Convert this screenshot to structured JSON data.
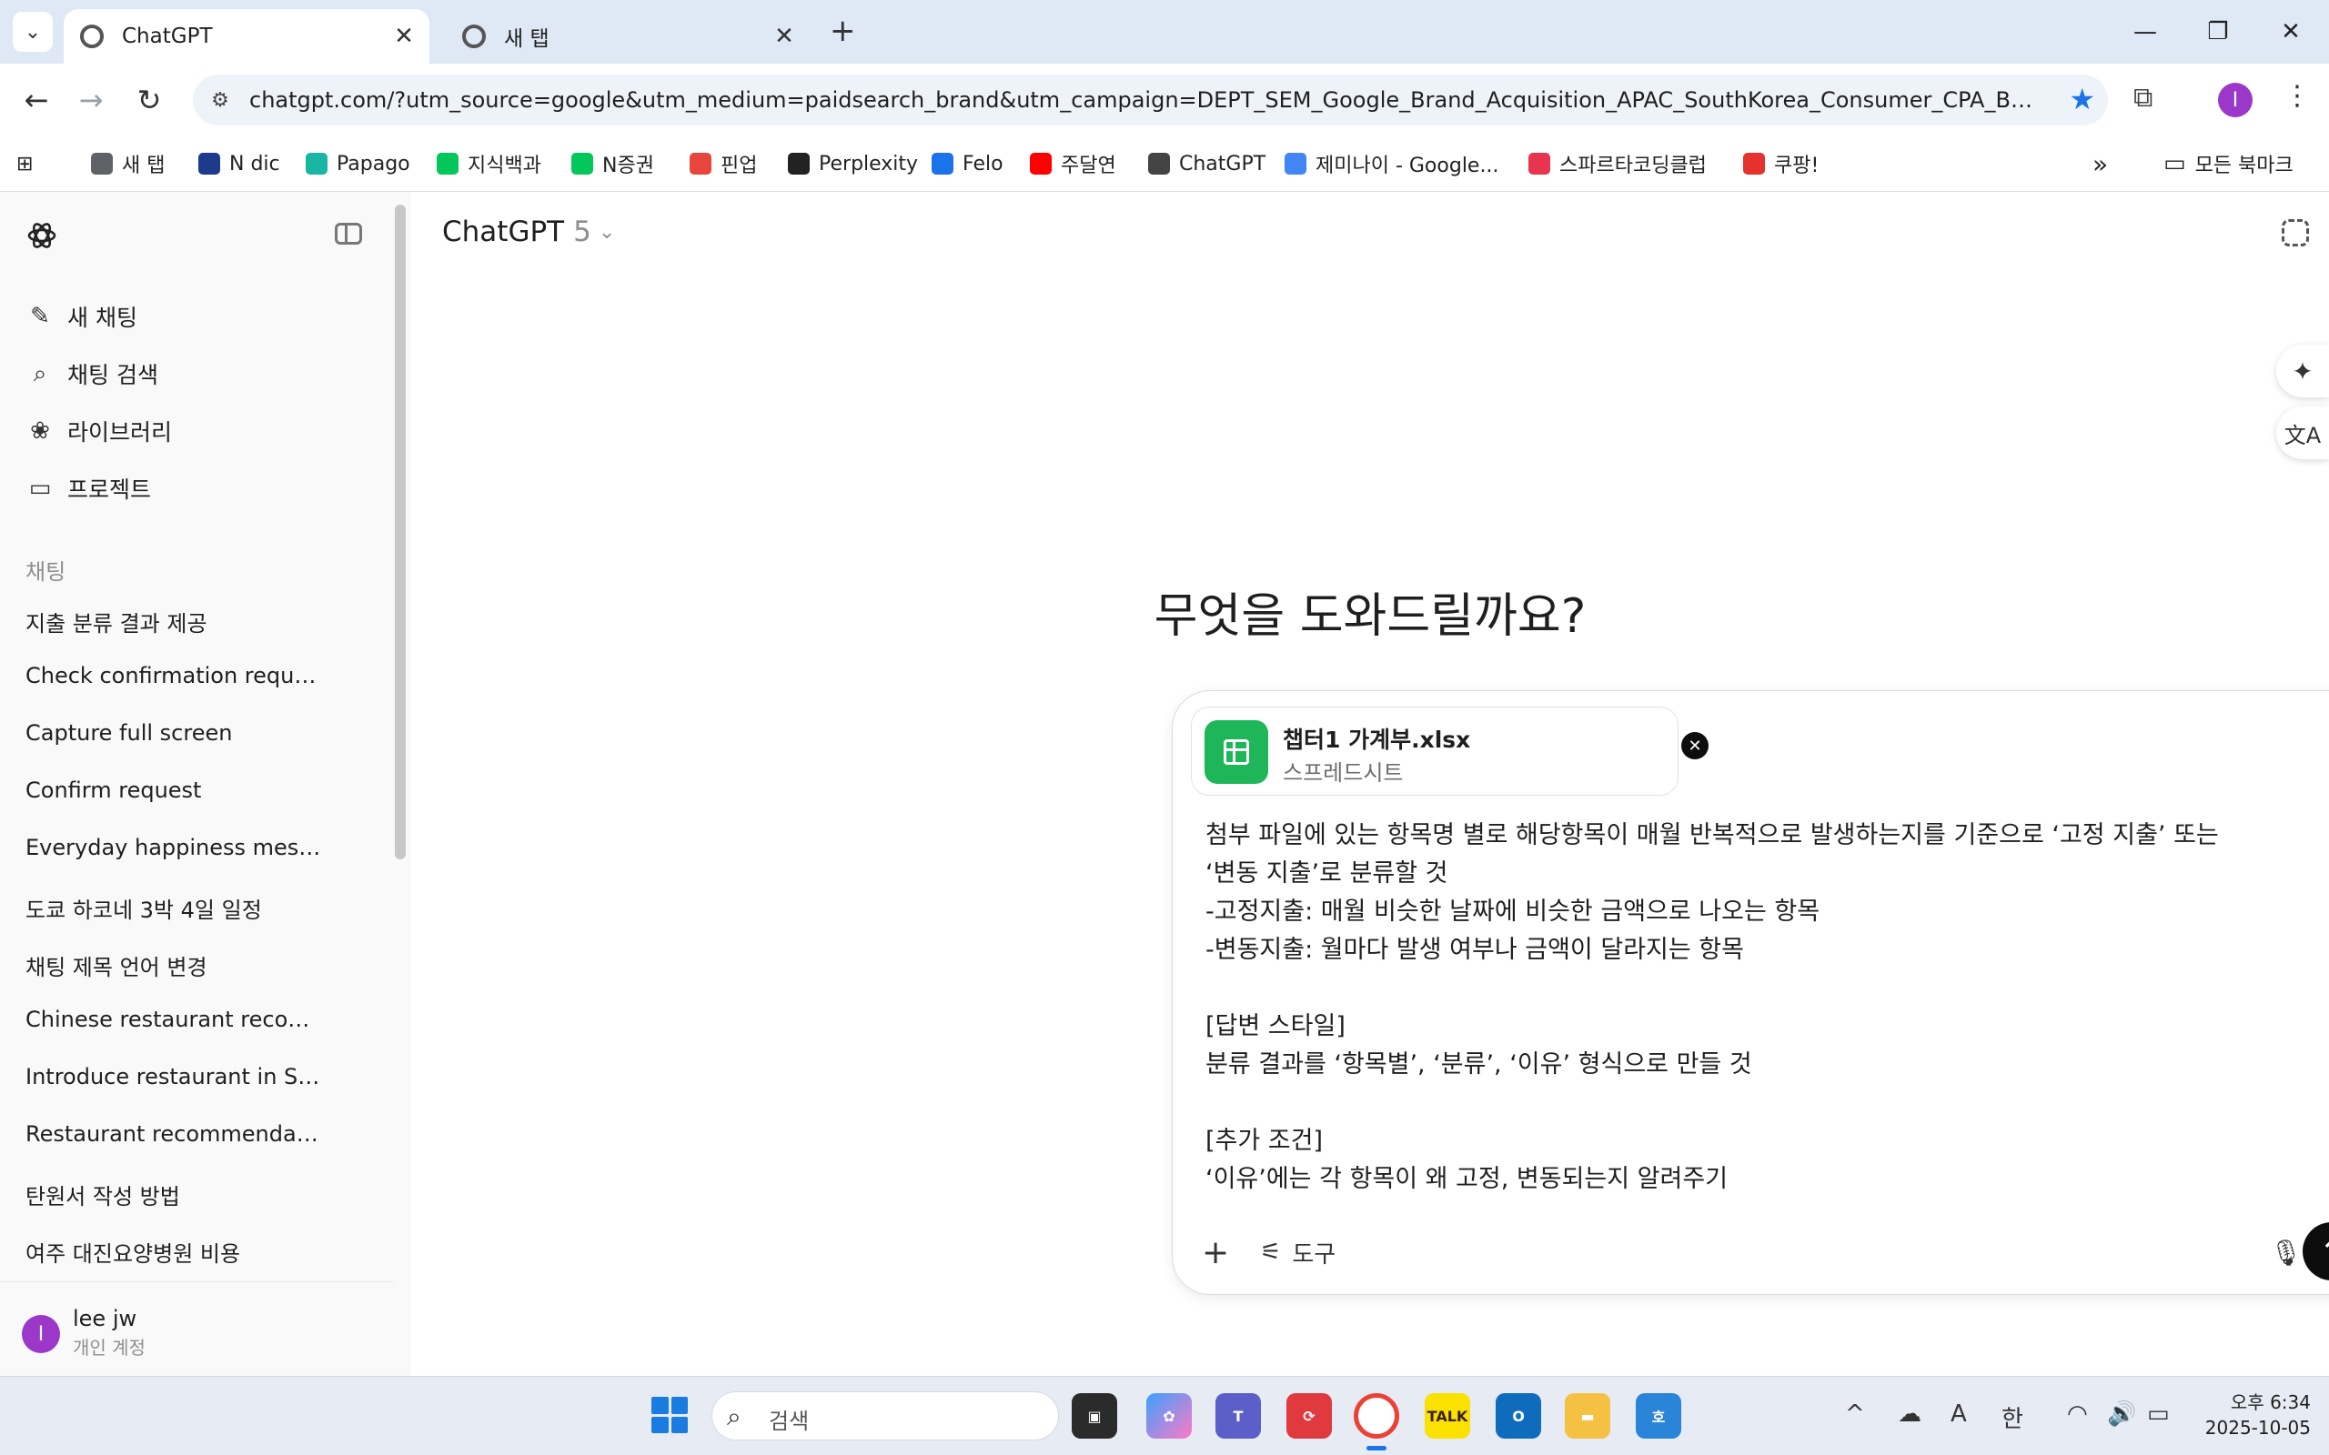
{
  "browser": {
    "tabs": [
      {
        "title": "ChatGPT",
        "active": true
      },
      {
        "title": "새 탭",
        "active": false
      }
    ],
    "new_tab_symbol": "+",
    "window_controls": {
      "minimize": "—",
      "restore": "❐",
      "close": "✕"
    },
    "url": "chatgpt.com/?utm_source=google&utm_medium=paidsearch_brand&utm_campaign=DEPT_SEM_Google_Brand_Acquisition_APAC_SouthKorea_Consumer_CPA_BAU_Mix_Korea...",
    "profile_initial": "I",
    "bookmarks": [
      {
        "label": "새 탭",
        "icon": "globe-icon",
        "color": "#5f6368"
      },
      {
        "label": "N dic",
        "icon": "naver-dic-icon",
        "color": "#1e3a8a"
      },
      {
        "label": "Papago",
        "icon": "papago-icon",
        "color": "#19b6a3"
      },
      {
        "label": "지식백과",
        "icon": "encyclopedia-icon",
        "color": "#03c75a"
      },
      {
        "label": "N증권",
        "icon": "npay-icon",
        "color": "#03c75a"
      },
      {
        "label": "핀업",
        "icon": "chart-icon",
        "color": "#e8453c"
      },
      {
        "label": "Perplexity",
        "icon": "perplexity-icon",
        "color": "#222222"
      },
      {
        "label": "Felo",
        "icon": "felo-icon",
        "color": "#1a73e8"
      },
      {
        "label": "주달연",
        "icon": "youtube-icon",
        "color": "#ff0000"
      },
      {
        "label": "ChatGPT",
        "icon": "openai-icon",
        "color": "#444444"
      },
      {
        "label": "제미나이 - Google...",
        "icon": "google-icon",
        "color": "#4285f4"
      },
      {
        "label": "스파르타코딩클럽",
        "icon": "sparta-icon",
        "color": "#e8344e"
      },
      {
        "label": "쿠팡!",
        "icon": "coupang-icon",
        "color": "#e5322d"
      }
    ],
    "bookmarks_overflow": "»",
    "all_bookmarks": "모든 북마크"
  },
  "sidebar": {
    "actions": [
      {
        "label": "새 채팅",
        "icon": "pencil-square-icon",
        "glyph": "✎"
      },
      {
        "label": "채팅 검색",
        "icon": "search-icon",
        "glyph": "⌕"
      },
      {
        "label": "라이브러리",
        "icon": "library-icon",
        "glyph": "❀"
      },
      {
        "label": "프로젝트",
        "icon": "folder-icon",
        "glyph": "▭"
      }
    ],
    "section_title": "채팅",
    "chats": [
      "지출 분류 결과 제공",
      "Check confirmation request",
      "Capture full screen",
      "Confirm request",
      "Everyday happiness message",
      "도쿄 하코네 3박 4일 일정",
      "채팅 제목 언어 변경",
      "Chinese restaurant recomm...",
      "Introduce restaurant in Seo...",
      "Restaurant recommendatio...",
      "탄원서 작성 방법",
      "여주 대진요양병원 비용"
    ],
    "user": {
      "initial": "I",
      "name": "lee jw",
      "plan": "개인 계정"
    }
  },
  "main": {
    "model_name": "ChatGPT",
    "model_version": "5",
    "hero": "무엇을 도와드릴까요?",
    "attachment": {
      "name": "챕터1 가계부.xlsx",
      "type": "스프레드시트"
    },
    "prompt_lines": [
      "첨부 파일에 있는 항목명 별로 해당항목이 매월 반복적으로 발생하는지를 기준으로 ‘고정 지출’ 또는",
      "‘변동 지출’로 분류할 것",
      "-고정지출: 매월 비슷한 날짜에 비슷한 금액으로 나오는 항목",
      "-변동지출: 월마다 발생 여부나 금액이 달라지는 항목",
      "",
      "[답변 스타일]",
      "분류 결과를 ‘항목별’, ‘분류’, ‘이유’ 형식으로 만들 것",
      "",
      "[추가 조건]",
      "‘이유’에는 각 항목이 왜 고정, 변동되는지 알려주기"
    ],
    "add_symbol": "+",
    "tools_label": "도구",
    "send_symbol": "↑"
  },
  "taskbar": {
    "search_placeholder": "검색",
    "tray_caret": "^",
    "ime_a": "A",
    "ime_lang": "한",
    "time": "오후 6:34",
    "date": "2025-10-05"
  },
  "colors": {
    "accent": "#1a73e8",
    "profile": "#9b38c9",
    "sheet_green": "#1fb65a",
    "sidebar_bg": "#f9f9f9",
    "tabbar_bg": "#dfe8f5"
  }
}
